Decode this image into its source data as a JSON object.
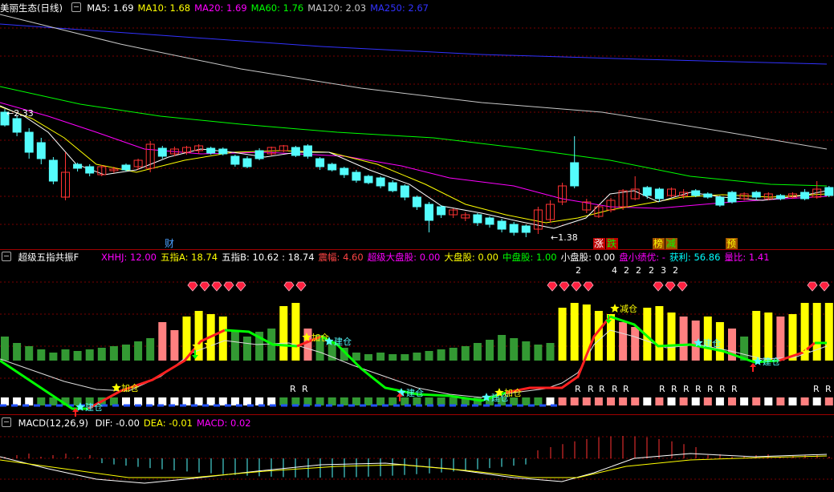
{
  "main": {
    "stock_name": "美丽生态",
    "period": "(日线)",
    "ma": [
      {
        "label": "MA5: 1.69",
        "color": "#ffffff"
      },
      {
        "label": "MA10: 1.68",
        "color": "#ffff00"
      },
      {
        "label": "MA20: 1.69",
        "color": "#ff00ff"
      },
      {
        "label": "MA60: 1.76",
        "color": "#00ff00"
      },
      {
        "label": "MA120: 2.03",
        "color": "#c8c8c8"
      },
      {
        "label": "MA250: 2.67",
        "color": "#3232ff"
      }
    ],
    "high_mark": "2.33",
    "low_mark": "1.38",
    "events": [
      {
        "text": "财",
        "color": "#4aa0ff"
      },
      {
        "text": "涨",
        "color": "#ffffff",
        "bg": "#c00000"
      },
      {
        "text": "跌",
        "color": "#00ff00",
        "bg": "#c00000"
      },
      {
        "text": "榜",
        "color": "#ffff00",
        "bg": "#a05000"
      },
      {
        "text": "减",
        "color": "#00ff00",
        "bg": "#a05000"
      },
      {
        "text": "预",
        "color": "#ffff00",
        "bg": "#a05000"
      }
    ]
  },
  "indicator": {
    "name": "超级五指共振F",
    "values": [
      {
        "label": "XHHJ: 12.00",
        "color": "#ff00ff"
      },
      {
        "label": "五指A: 18.74",
        "color": "#ffff00"
      },
      {
        "label": "五指B: 10.62 : 18.74",
        "color": "#ffffff"
      },
      {
        "label": "震幅: 4.60",
        "color": "#ff4444"
      },
      {
        "label": "超级大盘股: 0.00",
        "color": "#ff00ff"
      },
      {
        "label": "大盘股: 0.00",
        "color": "#ffff00"
      },
      {
        "label": "中盘股: 1.00",
        "color": "#00ff00"
      },
      {
        "label": "小盘股: 0.00",
        "color": "#ffffff"
      },
      {
        "label": "盘小绩优: -",
        "color": "#ff00ff"
      },
      {
        "label": "获利: 56.86",
        "color": "#00ffff"
      },
      {
        "label": "量比: 1.41",
        "color": "#ff00ff"
      }
    ],
    "digits": [
      "2",
      "4",
      "2",
      "2",
      "2",
      "3",
      "2"
    ],
    "signals": {
      "jiancang": "建仓",
      "jiacang": "加仓",
      "jiancang2": "减仓",
      "r": "R"
    }
  },
  "macd": {
    "name": "MACD(12,26,9)",
    "values": [
      {
        "label": "DIF: -0.00",
        "color": "#ffffff"
      },
      {
        "label": "DEA: -0.01",
        "color": "#ffff00"
      },
      {
        "label": "MACD: 0.02",
        "color": "#ff00ff"
      }
    ]
  },
  "colors": {
    "up": "#ff3232",
    "down": "#54fcfc",
    "grid": "#7a0000",
    "bar_yellow": "#ffff00",
    "bar_pink": "#ff8080",
    "bar_green": "#339933"
  }
}
